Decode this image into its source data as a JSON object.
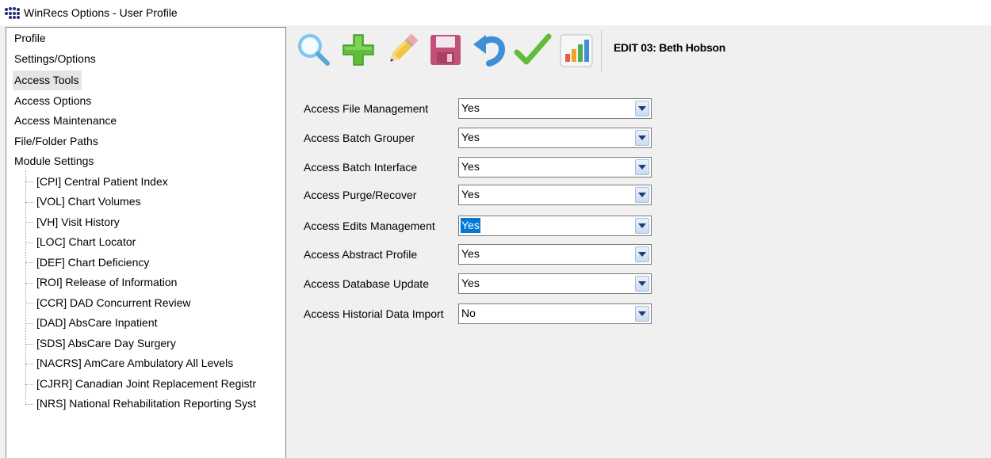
{
  "window": {
    "title": "WinRecs Options - User Profile"
  },
  "tree": {
    "items": [
      {
        "label": "Profile"
      },
      {
        "label": "Settings/Options"
      },
      {
        "label": "Access Tools"
      },
      {
        "label": "Access Options"
      },
      {
        "label": "Access Maintenance"
      },
      {
        "label": "File/Folder Paths"
      },
      {
        "label": "Module Settings"
      }
    ],
    "selected": "Access Tools",
    "children": [
      {
        "label": "[CPI] Central Patient Index"
      },
      {
        "label": "[VOL] Chart Volumes"
      },
      {
        "label": "[VH] Visit History"
      },
      {
        "label": "[LOC] Chart Locator"
      },
      {
        "label": "[DEF] Chart Deficiency"
      },
      {
        "label": "[ROI] Release of Information"
      },
      {
        "label": "[CCR] DAD Concurrent Review"
      },
      {
        "label": "[DAD] AbsCare Inpatient"
      },
      {
        "label": "[SDS] AbsCare Day Surgery"
      },
      {
        "label": "[NACRS] AmCare Ambulatory All Levels"
      },
      {
        "label": "[CJRR] Canadian Joint Replacement Registr"
      },
      {
        "label": "[NRS] National Rehabilitation Reporting Syst"
      }
    ]
  },
  "toolbar": {
    "buttons": [
      "search-icon",
      "add-icon",
      "edit-icon",
      "save-icon",
      "undo-icon",
      "checkmark-icon",
      "report-chart-icon"
    ],
    "edit_title": "EDIT 03: Beth Hobson"
  },
  "form": {
    "rows": [
      {
        "label": "Access File Management",
        "value": "Yes"
      },
      {
        "label": "Access Batch Grouper",
        "value": "Yes"
      },
      {
        "label": "Access Batch Interface",
        "value": "Yes"
      },
      {
        "label": "Access Purge/Recover",
        "value": "Yes"
      },
      {
        "label": "Access Edits Management",
        "value": "Yes",
        "focused": true
      },
      {
        "label": "Access Abstract Profile",
        "value": "Yes"
      },
      {
        "label": "Access Database Update",
        "value": "Yes"
      },
      {
        "label": "Access Historial Data Import",
        "value": "No"
      }
    ]
  },
  "colors": {
    "selection": "#0078d7",
    "tree_selected": "#e5e5e5",
    "background": "#f0f0f0"
  }
}
